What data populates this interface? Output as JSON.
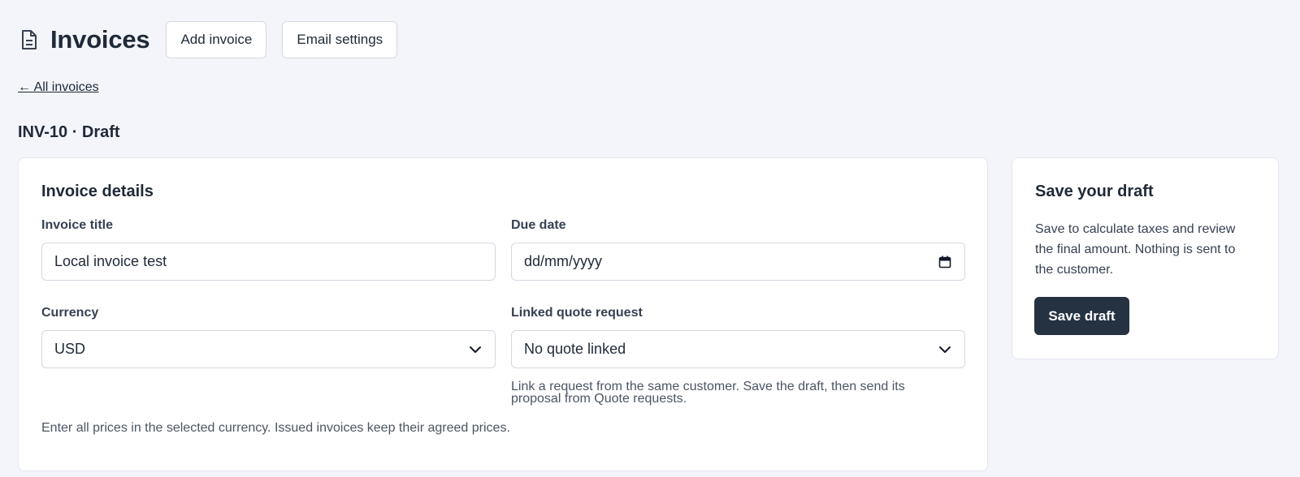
{
  "header": {
    "icon": "document-icon",
    "title": "Invoices",
    "add_invoice_label": "Add invoice",
    "email_settings_label": "Email settings"
  },
  "back_link": "← All invoices",
  "record_title": "INV-10 · Draft",
  "details": {
    "title": "Invoice details",
    "invoice_title_label": "Invoice title",
    "invoice_title_value": "Local invoice test",
    "due_date_label": "Due date",
    "due_date_placeholder": "dd/mm/yyyy",
    "currency_label": "Currency",
    "currency_value": "USD",
    "linked_quote_label": "Linked quote request",
    "linked_quote_value": "No quote linked",
    "linked_quote_help": "Link a request from the same customer. Save the draft, then send its proposal from Quote requests.",
    "currency_help": "Enter all prices in the selected currency. Issued invoices keep their agreed prices."
  },
  "sidebar": {
    "title": "Save your draft",
    "text": "Save to calculate taxes and review the final amount. Nothing is sent to the customer.",
    "save_label": "Save draft"
  },
  "colors": {
    "background": "#f3f5fb",
    "card": "#ffffff",
    "primary_button": "#253241",
    "text": "#1f2937"
  }
}
